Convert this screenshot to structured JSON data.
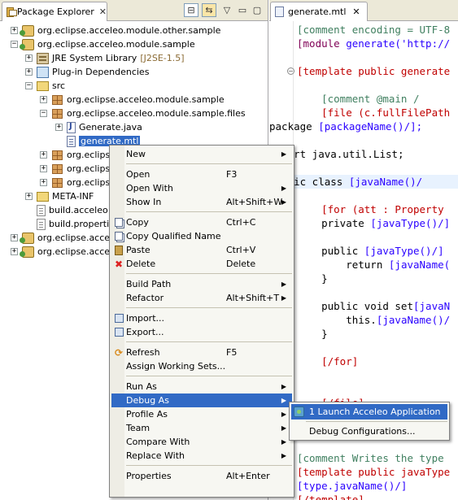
{
  "package_explorer": {
    "title": "Package Explorer",
    "tree": [
      {
        "label": "org.eclipse.acceleo.module.other.sample",
        "icon": "project-icon",
        "twisty": "+"
      },
      {
        "label": "org.eclipse.acceleo.module.sample",
        "icon": "project-icon",
        "twisty": "−"
      },
      {
        "label": "JRE System Library",
        "suffix": "[J2SE-1.5]",
        "icon": "library-icon",
        "twisty": "+"
      },
      {
        "label": "Plug-in Dependencies",
        "icon": "dependencies-icon",
        "twisty": "+"
      },
      {
        "label": "src",
        "icon": "source-folder-icon",
        "twisty": "−"
      },
      {
        "label": "org.eclipse.acceleo.module.sample",
        "icon": "package-icon",
        "twisty": "+"
      },
      {
        "label": "org.eclipse.acceleo.module.sample.files",
        "icon": "package-icon",
        "twisty": "−"
      },
      {
        "label": "Generate.java",
        "icon": "java-file-icon",
        "twisty": "+"
      },
      {
        "label": "generate.mtl",
        "icon": "mtl-file-icon",
        "selected": true
      },
      {
        "label": "org.eclips",
        "icon": "package-icon",
        "twisty": "+"
      },
      {
        "label": "org.eclips",
        "icon": "package-icon",
        "twisty": "+"
      },
      {
        "label": "org.eclips",
        "icon": "package-icon",
        "twisty": "+"
      },
      {
        "label": "META-INF",
        "icon": "folder-icon",
        "twisty": "+"
      },
      {
        "label": "build.acceleo",
        "icon": "file-icon"
      },
      {
        "label": "build.properti",
        "icon": "file-icon"
      },
      {
        "label": "org.eclipse.accele",
        "icon": "project-icon",
        "twisty": "+"
      },
      {
        "label": "org.eclipse.accele",
        "icon": "project-icon",
        "twisty": "+"
      }
    ]
  },
  "editor": {
    "tab_title": "generate.mtl",
    "lines": [
      [
        {
          "t": "[comment encoding = UTF-8",
          "c": "comment"
        }
      ],
      [
        {
          "t": "[module ",
          "c": "kw"
        },
        {
          "t": "generate('http://",
          "c": "expr"
        }
      ],
      [],
      [
        {
          "t": "[template public generate",
          "c": "dir"
        }
      ],
      [],
      [
        {
          "t": "    [comment @main /",
          "c": "comment"
        }
      ],
      [
        {
          "t": "    [file (c.fullFilePath",
          "c": "dir"
        }
      ],
      [
        {
          "t": "package ",
          "c": "plain"
        },
        {
          "t": "[packageName()/];",
          "c": "expr"
        }
      ],
      [],
      [
        {
          "t": "import java.util.List;",
          "c": "plain"
        }
      ],
      [],
      [
        {
          "t": "public class ",
          "c": "plain"
        },
        {
          "t": "[javaName()/",
          "c": "expr"
        }
      ],
      [],
      [
        {
          "t": "    [for (att : Property",
          "c": "dir"
        }
      ],
      [
        {
          "t": "    private ",
          "c": "plain"
        },
        {
          "t": "[javaType()/]",
          "c": "expr"
        }
      ],
      [],
      [
        {
          "t": "    public ",
          "c": "plain"
        },
        {
          "t": "[javaType()/]",
          "c": "expr"
        }
      ],
      [
        {
          "t": "        return ",
          "c": "plain"
        },
        {
          "t": "[javaName(",
          "c": "expr"
        }
      ],
      [
        {
          "t": "    }",
          "c": "plain"
        }
      ],
      [],
      [
        {
          "t": "    public void set",
          "c": "plain"
        },
        {
          "t": "[javaN",
          "c": "expr"
        }
      ],
      [
        {
          "t": "        this.",
          "c": "plain"
        },
        {
          "t": "[javaName()/",
          "c": "expr"
        }
      ],
      [
        {
          "t": "    }",
          "c": "plain"
        }
      ],
      [],
      [
        {
          "t": "    [/for]",
          "c": "dir"
        }
      ],
      [
        {
          "t": "}",
          "c": "plain"
        }
      ],
      [],
      [
        {
          "t": "    [/file]",
          "c": "dir"
        }
      ],
      [],
      [],
      [],
      [
        {
          "t": "[comment Writes the type",
          "c": "comment"
        }
      ],
      [
        {
          "t": "[template public javaType",
          "c": "dir"
        }
      ],
      [
        {
          "t": "[type.javaName()/]",
          "c": "expr"
        }
      ],
      [
        {
          "t": "[/template]",
          "c": "dir"
        }
      ]
    ]
  },
  "context_menu": {
    "items": [
      {
        "label": "New",
        "submenu": true
      },
      {
        "sep": true
      },
      {
        "label": "Open",
        "accel": "F3"
      },
      {
        "label": "Open With",
        "submenu": true
      },
      {
        "label": "Show In",
        "accel": "Alt+Shift+W",
        "submenu": true
      },
      {
        "sep": true
      },
      {
        "label": "Copy",
        "accel": "Ctrl+C",
        "icon": "copy-icon"
      },
      {
        "label": "Copy Qualified Name",
        "icon": "copy-qualified-icon"
      },
      {
        "label": "Paste",
        "accel": "Ctrl+V",
        "icon": "paste-icon"
      },
      {
        "label": "Delete",
        "accel": "Delete",
        "icon": "delete-icon"
      },
      {
        "sep": true
      },
      {
        "label": "Build Path",
        "submenu": true
      },
      {
        "label": "Refactor",
        "accel": "Alt+Shift+T",
        "submenu": true
      },
      {
        "sep": true
      },
      {
        "label": "Import...",
        "icon": "import-icon"
      },
      {
        "label": "Export...",
        "icon": "export-icon"
      },
      {
        "sep": true
      },
      {
        "label": "Refresh",
        "accel": "F5",
        "icon": "refresh-icon"
      },
      {
        "label": "Assign Working Sets..."
      },
      {
        "sep": true
      },
      {
        "label": "Run As",
        "submenu": true
      },
      {
        "label": "Debug As",
        "submenu": true,
        "active": true
      },
      {
        "label": "Profile As",
        "submenu": true
      },
      {
        "label": "Team",
        "submenu": true
      },
      {
        "label": "Compare With",
        "submenu": true
      },
      {
        "label": "Replace With",
        "submenu": true
      },
      {
        "sep": true
      },
      {
        "label": "Properties",
        "accel": "Alt+Enter"
      }
    ]
  },
  "debug_submenu": {
    "items": [
      {
        "label": "1 Launch Acceleo Application",
        "icon": "acceleo-launch-icon",
        "active": true
      },
      {
        "label": "Debug Configurations..."
      }
    ]
  },
  "colors": {
    "selection": "#316ac5",
    "menu_bg": "#f7f7f2",
    "comment": "#3f7f5f",
    "keyword": "#7f0055",
    "directive": "#c00000",
    "expression": "#2a00ff"
  }
}
